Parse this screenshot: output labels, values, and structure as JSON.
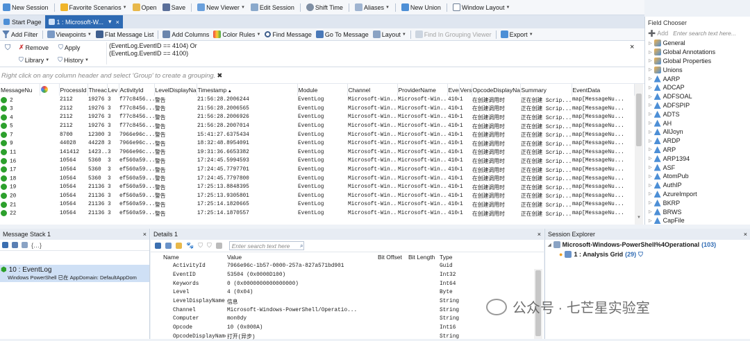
{
  "menubar": {
    "new_session": "New Session",
    "favorite_scenarios": "Favorite Scenarios",
    "open": "Open",
    "save": "Save",
    "new_viewer": "New Viewer",
    "edit_session": "Edit Session",
    "shift_time": "Shift Time",
    "aliases": "Aliases",
    "new_union": "New Union",
    "window_layout": "Window Layout"
  },
  "tabs": {
    "start_page": "Start Page",
    "active": "1 : Microsoft-W...",
    "pin": "▾",
    "close": "×"
  },
  "viewer_toolbar": {
    "add_filter": "Add Filter",
    "viewpoints": "Viewpoints",
    "flat_message_list": "Flat Message List",
    "add_columns": "Add Columns",
    "color_rules": "Color Rules",
    "find_message": "Find Message",
    "go_to_message": "Go To Message",
    "layout": "Layout",
    "find_in_grouping_viewer": "Find In Grouping Viewer",
    "export": "Export"
  },
  "filter": {
    "remove": "Remove",
    "apply": "Apply",
    "library": "Library",
    "history": "History",
    "expression_line1": "(EventLog.EventID == 4104) Or",
    "expression_line2": "(EventLog.EventID == 4100)",
    "close": "×"
  },
  "group_hint": "Right click on any column header and select 'Group' to create a grouping.",
  "grid": {
    "columns": [
      "MessageNu",
      "",
      "ProcessId",
      "Threac",
      "Lev",
      "ActivityId",
      "LevelDisplayNa",
      "Timestamp",
      "Module",
      "Channel",
      "ProviderName",
      "EventI",
      "Vers",
      "OpcodeDisplayNa",
      "Summary",
      "EventData"
    ],
    "rows": [
      [
        "2",
        "2112",
        "19276",
        "3",
        "f77c8456...",
        "警告",
        "21:56:28.2006244",
        "EventLog",
        "Microsoft-Win...",
        "Microsoft-Win...",
        "4104",
        "1",
        "在创建调用时",
        "正在创建 Scrip...",
        "map[MessageNu..."
      ],
      [
        "3",
        "2112",
        "19276",
        "3",
        "f77c8456...",
        "警告",
        "21:56:28.2006565",
        "EventLog",
        "Microsoft-Win...",
        "Microsoft-Win...",
        "4104",
        "1",
        "在创建调用时",
        "正在创建 Scrip...",
        "map[MessageNu..."
      ],
      [
        "4",
        "2112",
        "19276",
        "3",
        "f77c8456...",
        "警告",
        "21:56:28.2006926",
        "EventLog",
        "Microsoft-Win...",
        "Microsoft-Win...",
        "4104",
        "1",
        "在创建调用时",
        "正在创建 Scrip...",
        "map[MessageNu..."
      ],
      [
        "5",
        "2112",
        "19276",
        "3",
        "f77c8456...",
        "警告",
        "21:56:28.2007014",
        "EventLog",
        "Microsoft-Win...",
        "Microsoft-Win...",
        "4104",
        "1",
        "在创建调用时",
        "正在创建 Scrip...",
        "map[MessageNu..."
      ],
      [
        "7",
        "8700",
        "12300",
        "3",
        "7966e96c...",
        "警告",
        "15:41:27.6375434",
        "EventLog",
        "Microsoft-Win...",
        "Microsoft-Win...",
        "4104",
        "1",
        "在创建调用时",
        "正在创建 Scrip...",
        "map[MessageNu..."
      ],
      [
        "9",
        "44028",
        "44228",
        "3",
        "7966e96c...",
        "警告",
        "18:32:48.8954091",
        "EventLog",
        "Microsoft-Win...",
        "Microsoft-Win...",
        "4104",
        "1",
        "在创建调用时",
        "正在创建 Scrip...",
        "map[MessageNu..."
      ],
      [
        "11",
        "141412",
        "1423...",
        "3",
        "7966e96c...",
        "警告",
        "19:31:36.6653382",
        "EventLog",
        "Microsoft-Win...",
        "Microsoft-Win...",
        "4104",
        "1",
        "在创建调用时",
        "正在创建 Scrip...",
        "map[MessageNu..."
      ],
      [
        "16",
        "10564",
        "5360",
        "3",
        "ef560a59...",
        "警告",
        "17:24:45.5994593",
        "EventLog",
        "Microsoft-Win...",
        "Microsoft-Win...",
        "4104",
        "1",
        "在创建调用时",
        "正在创建 Scrip...",
        "map[MessageNu..."
      ],
      [
        "17",
        "10564",
        "5360",
        "3",
        "ef560a59...",
        "警告",
        "17:24:45.7797701",
        "EventLog",
        "Microsoft-Win...",
        "Microsoft-Win...",
        "4104",
        "1",
        "在创建调用时",
        "正在创建 Scrip...",
        "map[MessageNu..."
      ],
      [
        "18",
        "10564",
        "5360",
        "3",
        "ef560a59...",
        "警告",
        "17:24:45.7797800",
        "EventLog",
        "Microsoft-Win...",
        "Microsoft-Win...",
        "4104",
        "1",
        "在创建调用时",
        "正在创建 Scrip...",
        "map[MessageNu..."
      ],
      [
        "19",
        "10564",
        "21136",
        "3",
        "ef560a59...",
        "警告",
        "17:25:13.8848395",
        "EventLog",
        "Microsoft-Win...",
        "Microsoft-Win...",
        "4104",
        "1",
        "在创建调用时",
        "正在创建 Scrip...",
        "map[MessageNu..."
      ],
      [
        "20",
        "10564",
        "21136",
        "3",
        "ef560a59...",
        "警告",
        "17:25:13.9305801",
        "EventLog",
        "Microsoft-Win...",
        "Microsoft-Win...",
        "4104",
        "1",
        "在创建调用时",
        "正在创建 Scrip...",
        "map[MessageNu..."
      ],
      [
        "21",
        "10564",
        "21136",
        "3",
        "ef560a59...",
        "警告",
        "17:25:14.1820665",
        "EventLog",
        "Microsoft-Win...",
        "Microsoft-Win...",
        "4104",
        "1",
        "在创建调用时",
        "正在创建 Scrip...",
        "map[MessageNu..."
      ],
      [
        "22",
        "10564",
        "21136",
        "3",
        "ef560a59...",
        "警告",
        "17:25:14.1870557",
        "EventLog",
        "Microsoft-Win...",
        "Microsoft-Win...",
        "4104",
        "1",
        "在创建调用时",
        "正在创建 Scrip...",
        "map[MessageNu..."
      ]
    ]
  },
  "field_chooser": {
    "title": "Field Chooser",
    "add": "Add",
    "search_placeholder": "Enter search text here...",
    "items": [
      "General",
      "Global Annotations",
      "Global Properties",
      "Unions",
      "AARP",
      "ADCAP",
      "ADFSOAL",
      "ADFSPIP",
      "ADTS",
      "AH",
      "AllJoyn",
      "ARDP",
      "ARP",
      "ARP1394",
      "ASF",
      "AtomPub",
      "AuthIP",
      "AzureImport",
      "BKRP",
      "BRWS",
      "CapFile"
    ]
  },
  "message_stack": {
    "title": "Message Stack 1",
    "close": "×",
    "entry_title": "10 : EventLog",
    "entry_subtitle": "Windows PowerShell 已在 AppDomain: DefaultAppDom"
  },
  "details": {
    "title": "Details 1",
    "close": "×",
    "search_placeholder": "Enter search text here",
    "columns": [
      "Name",
      "Value",
      "Bit Offset",
      "Bit Length",
      "Type"
    ],
    "rows": [
      [
        "ActivityId",
        "7966e96c-1b57-0000-257a-827a571bd901",
        "",
        "",
        "Guid"
      ],
      [
        "EventID",
        "53504 (0x0000D100)",
        "",
        "",
        "Int32"
      ],
      [
        "Keywords",
        "0 (0x0000000000000000)",
        "",
        "",
        "Int64"
      ],
      [
        "Level",
        "4 (0x04)",
        "",
        "",
        "Byte"
      ],
      [
        "LevelDisplayName",
        "信息",
        "",
        "",
        "String"
      ],
      [
        "Channel",
        "Microsoft-Windows-PowerShell/Operatio...",
        "",
        "",
        "String"
      ],
      [
        "Computer",
        "mon0dy",
        "",
        "",
        "String"
      ],
      [
        "Opcode",
        "10 (0x000A)",
        "",
        "",
        "Int16"
      ],
      [
        "OpcodeDisplayName",
        "打开(异步)",
        "",
        "",
        "String"
      ]
    ]
  },
  "session_explorer": {
    "title": "Session Explorer",
    "close": "×",
    "root_label": "Microsoft-Windows-PowerShell%4Operational",
    "root_count": "(103)",
    "child_label": "1 : Analysis Grid",
    "child_count": "(29)"
  },
  "watermark": {
    "text": "公众号 · 七芒星实验室"
  },
  "colors": {
    "accent": "#2e6ab3",
    "row_dot": "#2ca02c",
    "selected": "#cfe0f5"
  }
}
